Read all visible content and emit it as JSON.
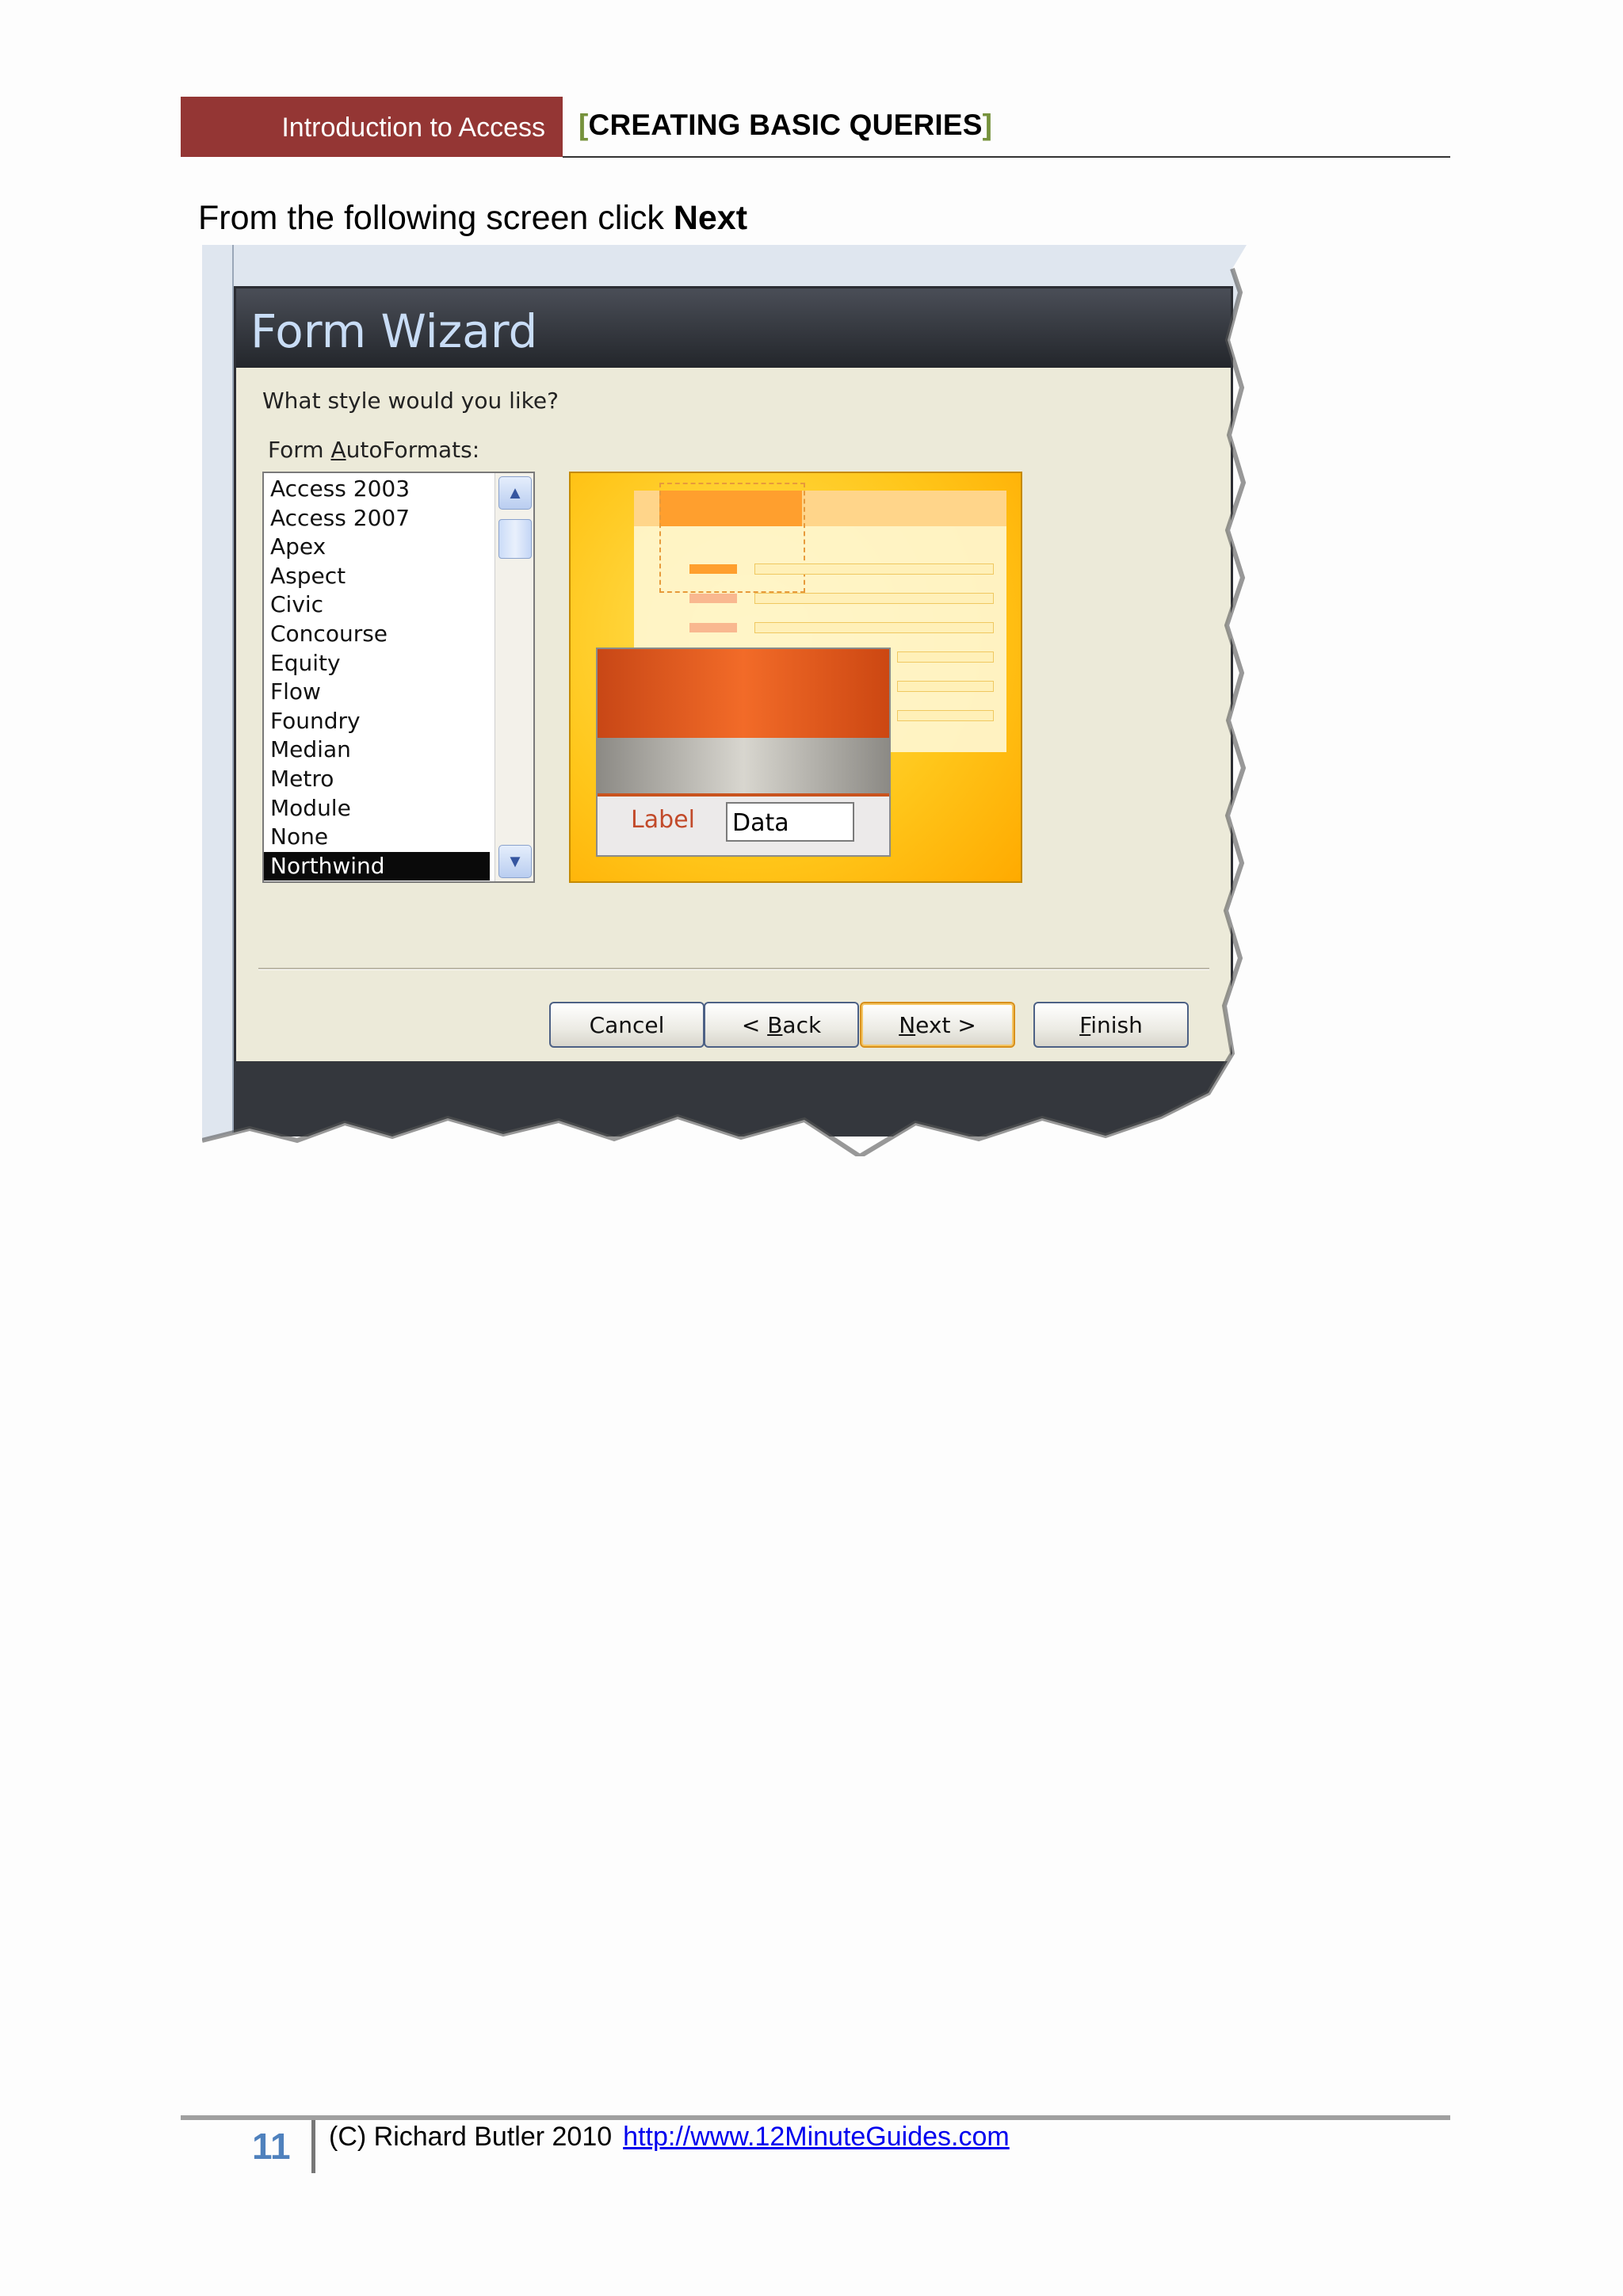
{
  "header": {
    "chapter": "Introduction to Access",
    "bracket_open": "[",
    "section": "CREATING BASIC QUERIES",
    "bracket_close": "]"
  },
  "instruction": {
    "text": "From the following screen click ",
    "emphasis": "Next"
  },
  "wizard": {
    "title": "Form Wizard",
    "question": "What style would you like?",
    "list_label_pre": "Form ",
    "list_label_underlined": "A",
    "list_label_post": "utoFormats:",
    "items": [
      "Access 2003",
      "Access 2007",
      "Apex",
      "Aspect",
      "Civic",
      "Concourse",
      "Equity",
      "Flow",
      "Foundry",
      "Median",
      "Metro",
      "Module",
      "None",
      "Northwind"
    ],
    "selected": "Northwind",
    "preview": {
      "label_text": "Label",
      "data_text": "Data"
    },
    "buttons": {
      "cancel": "Cancel",
      "back_pre": "< ",
      "back_u": "B",
      "back_post": "ack",
      "next_u": "N",
      "next_post": "ext >",
      "finish_u": "F",
      "finish_post": "inish"
    },
    "icons": {
      "scroll_up": "chevron-up-icon",
      "scroll_down": "chevron-down-icon"
    },
    "colors": {
      "title_text": "#c9ddf6",
      "selection": "#0a0a0a",
      "default_button": "#d8901c"
    }
  },
  "footer": {
    "page_number": "11",
    "copyright": "(C) Richard Butler 2010",
    "url": "http://www.12MinuteGuides.com"
  },
  "colors": {
    "header_red": "#943634",
    "bracket_green": "#76923c",
    "page_number_blue": "#4f81bd"
  }
}
